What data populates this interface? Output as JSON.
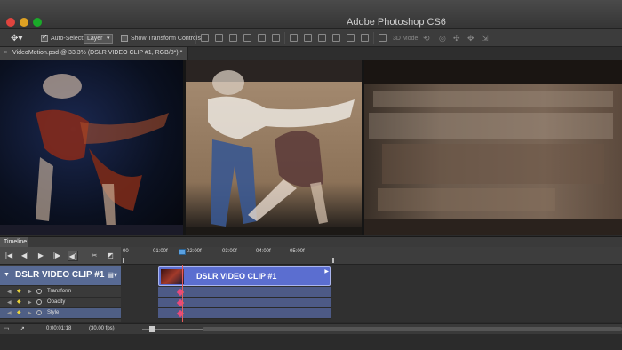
{
  "app": {
    "title": "Adobe Photoshop CS6"
  },
  "options_bar": {
    "auto_select_label": "Auto-Select:",
    "auto_select_value": "Layer",
    "show_transform_label": "Show Transform Controls",
    "mode_3d_label": "3D Mode:"
  },
  "document": {
    "tab_title": "VideoMotion.psd @ 33.3% (DSLR VIDEO CLIP #1, RGB/8*) *"
  },
  "timeline": {
    "tab_label": "Timeline",
    "ruler_ticks": [
      "00",
      "01:00f",
      "02:00f",
      "03:00f",
      "04:00f",
      "05:00f"
    ],
    "track_name": "DSLR VIDEO CLIP #1",
    "clip_label": "DSLR VIDEO CLIP #1",
    "properties": [
      "Transform",
      "Opacity",
      "Style"
    ],
    "current_time": "0:00:01:18",
    "fps": "(30.00 fps)"
  }
}
